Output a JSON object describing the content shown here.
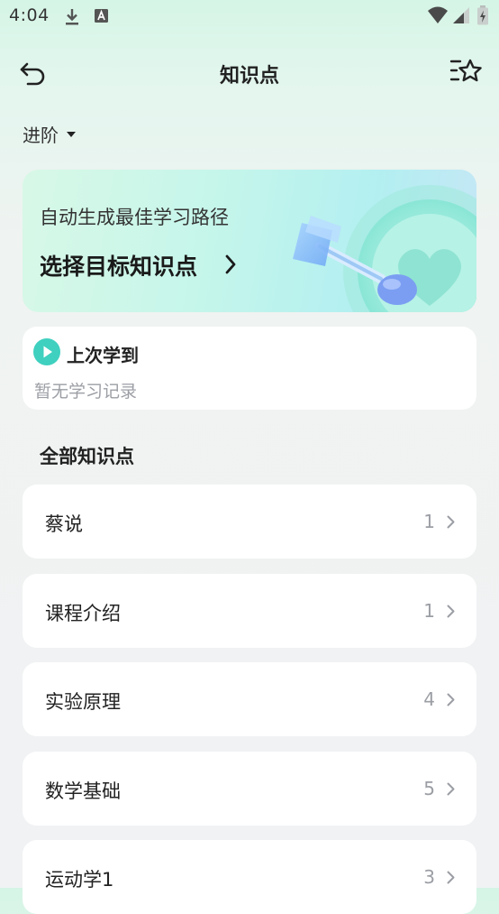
{
  "status_bar": {
    "time": "4:04"
  },
  "header": {
    "title": "知识点"
  },
  "level_selector": {
    "label": "进阶"
  },
  "banner": {
    "subtitle": "自动生成最佳学习路径",
    "action": "选择目标知识点"
  },
  "recent": {
    "title": "上次学到",
    "empty_text": "暂无学习记录"
  },
  "all_points": {
    "title": "全部知识点",
    "items": [
      {
        "name": "蔡说",
        "count": "1"
      },
      {
        "name": "课程介绍",
        "count": "1"
      },
      {
        "name": "实验原理",
        "count": "4"
      },
      {
        "name": "数学基础",
        "count": "5"
      },
      {
        "name": "运动学1",
        "count": "3"
      }
    ]
  },
  "colors": {
    "accent": "#3fd0bf",
    "background_top": "#d5f5e6",
    "banner_end": "#c6e6f6"
  },
  "icons": [
    "download-icon",
    "accessibility-icon",
    "wifi-icon",
    "signal-icon",
    "battery-icon",
    "back-icon",
    "star-list-icon",
    "caret-down-icon",
    "chevron-right-icon",
    "play-icon"
  ]
}
